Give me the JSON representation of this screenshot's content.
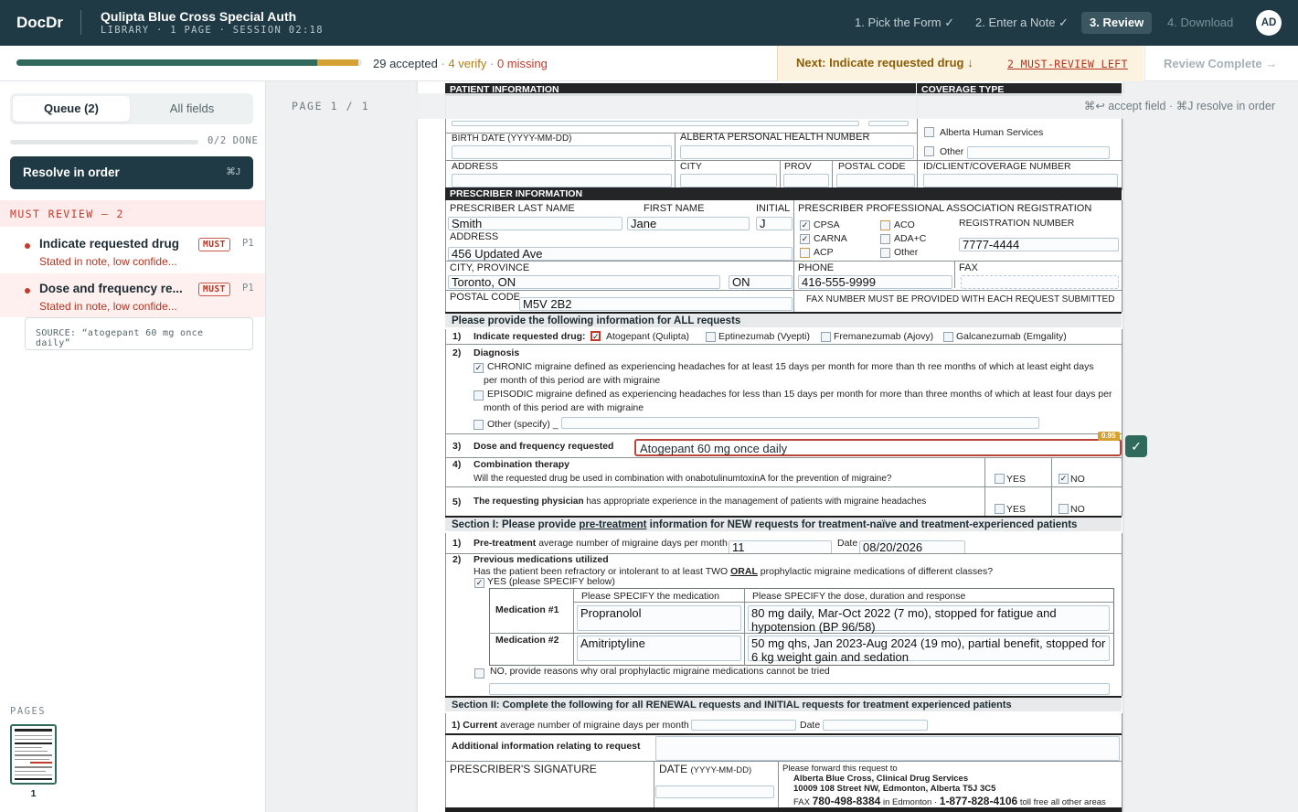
{
  "app": {
    "brand": "DocDr",
    "title": "Qulipta Blue Cross Special Auth",
    "subtitle": "LIBRARY · 1 PAGE · SESSION 02:18",
    "avatar": "AD"
  },
  "steps": [
    {
      "label": "1. Pick the Form ✓",
      "state": "done"
    },
    {
      "label": "2. Enter a Note ✓",
      "state": "done"
    },
    {
      "label": "3. Review",
      "state": "active"
    },
    {
      "label": "4. Download",
      "state": "future"
    }
  ],
  "status": {
    "accepted": "29 accepted",
    "verify": "4 verify",
    "missing": "0 missing",
    "sep": "·",
    "progress_accepted_fraction": 0.87,
    "progress_verify_fraction": 0.12,
    "next": "Next: Indicate requested drug ↓",
    "must_left": "2 MUST-REVIEW LEFT",
    "complete": "Review Complete →"
  },
  "sidebar": {
    "tabs": [
      "Queue (2)",
      "All fields"
    ],
    "done": "0/2 DONE",
    "resolve": "Resolve in order",
    "resolve_kbd": "⌘J",
    "must_header": "MUST REVIEW — 2",
    "items": [
      {
        "name": "Indicate requested drug",
        "sub": "Stated in note, low confide...",
        "badge": "MUST",
        "page": "P1"
      },
      {
        "name": "Dose and frequency re...",
        "sub": "Stated in note, low confide...",
        "badge": "MUST",
        "page": "P1"
      }
    ],
    "source": "SOURCE: “atogepant 60 mg once daily”",
    "pages_label": "PAGES",
    "thumb_num": "1"
  },
  "doc": {
    "page_ind": "PAGE 1 / 1",
    "hints": "⌘↩ accept field · ⌘J resolve in order",
    "hdr": {
      "patient": "PATIENT INFORMATION",
      "coverage": "COVERAGE TYPE",
      "birth": "BIRTH DATE (YYYY-MM-DD)",
      "phn": "ALBERTA PERSONAL HEALTH NUMBER",
      "address": "ADDRESS",
      "city": "CITY",
      "prov": "PROV",
      "postal": "POSTAL CODE",
      "idnum": "ID/CLIENT/COVERAGE NUMBER",
      "ahs": "Alberta Human Services",
      "other": "Other"
    },
    "prescriber": {
      "section": "PRESCRIBER INFORMATION",
      "last": "PRESCRIBER LAST NAME",
      "first": "FIRST NAME",
      "initial": "INITIAL",
      "assoc": "PRESCRIBER PROFESSIONAL ASSOCIATION REGISTRATION",
      "last_val": "Smith",
      "first_val": "Jane",
      "initial_val": "J",
      "cpsa": "CPSA",
      "carna": "CARNA",
      "acp": "ACP",
      "aco": "ACO",
      "adac": "ADA+C",
      "oth": "Other",
      "regno": "REGISTRATION NUMBER",
      "regno_val": "7777-4444",
      "address": "ADDRESS",
      "address_val": "456 Updated Ave",
      "cityprov": "CITY, PROVINCE",
      "city_val": "Toronto, ON",
      "prov_val": "ON",
      "phone": "PHONE",
      "phone_val": "416-555-9999",
      "fax": "FAX",
      "postal": "POSTAL CODE",
      "postal_val": "M5V 2B2",
      "faxnote": "FAX NUMBER MUST BE PROVIDED WITH EACH REQUEST SUBMITTED"
    },
    "all": {
      "section": "Please provide the following information for ALL requests",
      "q1n": "1)",
      "q1": "Indicate requested drug:",
      "drugs": [
        "Atogepant (Qulipta)",
        "Eptinezumab (Vyepti)",
        "Fremanezumab (Ajovy)",
        "Galcanezumab (Emgality)"
      ],
      "q2n": "2)",
      "q2": "Diagnosis",
      "chronic1": "CHRONIC migraine defined as experiencing headaches for at least 15 days per month for more than th    ree months of which at least  eight days",
      "chronic2": "per month of this period are with migraine",
      "episodic1": "EPISODIC migraine defined as experiencing headaches for less than 15 days per month for more than three months of which at least four days per",
      "episodic2": "month of this period are with migraine",
      "otherspec": "Other (specify) _",
      "q3n": "3)",
      "q3": "Dose and frequency requested",
      "dose_val": "Atogepant 60 mg once daily",
      "confidence": "0.95",
      "accept": "✓",
      "q4n": "4)",
      "q4": "Combination therapy",
      "q4sub": "Will the requested drug be used in combination with onabotulinumtoxinA for the prevention of migraine?",
      "yes": "YES",
      "no": "NO",
      "q5n": "5)",
      "q5a": "The requesting physician",
      "q5b": "has appropriate experience in the management of patients with migraine headaches"
    },
    "s1": {
      "section_a": "Section I: Please provide ",
      "section_u": "pre-treatment",
      "section_b": " information for NEW requests for treatment-naïve and treatment-experienced patients",
      "q1n": "1)",
      "q1a": "Pre-treatment",
      "q1b": "average number of migraine days per month",
      "days_val": "11",
      "date": "Date",
      "date_val": "08/20/2026",
      "q2n": "2)",
      "q2": "Previous medications utilized",
      "q2sub_a": "Has the patient been refractory or intolerant to at least TWO ",
      "q2sub_u": "ORAL",
      "q2sub_b": " prophylactic migraine medications of different classes?",
      "yesspec": "YES (please SPECIFY below)",
      "col1": "Please SPECIFY the medication",
      "col2": "Please SPECIFY the dose, duration and response",
      "med1": "Medication #1",
      "med1_name": "Propranolol",
      "med1_detail": "80 mg daily, Mar-Oct 2022 (7 mo), stopped for fatigue and hypotension (BP 96/58)",
      "med2": "Medication #2",
      "med2_name": "Amitriptyline",
      "med2_detail": "50 mg qhs, Jan 2023-Aug 2024 (19 mo), partial benefit, stopped for 6 kg weight gain and sedation",
      "noreason": "NO, provide reasons why oral prophylactic migraine medications cannot be tried"
    },
    "s2": {
      "section": "Section II: Complete the following for all RENEWAL requests and INITIAL requests for treatment experienced patients",
      "q1a": "1) Current",
      "q1b": "average number of migraine days per month",
      "date": "Date"
    },
    "footer": {
      "addl": "Additional information relating to request",
      "sig": "PRESCRIBER'S SIGNATURE",
      "date": "DATE",
      "datefmt": "(YYYY-MM-DD)",
      "fwd": "Please forward this request to",
      "org": "Alberta Blue Cross, Clinical Drug Services",
      "addr": "10009 108 Street NW, Edmonton, Alberta  T5J 3C5",
      "fax_a": "FAX",
      "fax_b": "780-498-8384",
      "fax_c": "in Edmonton",
      "fax_d": "1-877-828-4106",
      "fax_e": "toll free all other areas"
    },
    "checks": {
      "checked": "✓"
    }
  },
  "colors": {
    "topbar": "#1f3a44",
    "accent_green": "#2f6a5d",
    "verify_amber": "#d5a130",
    "must_red": "#c23a2a"
  }
}
